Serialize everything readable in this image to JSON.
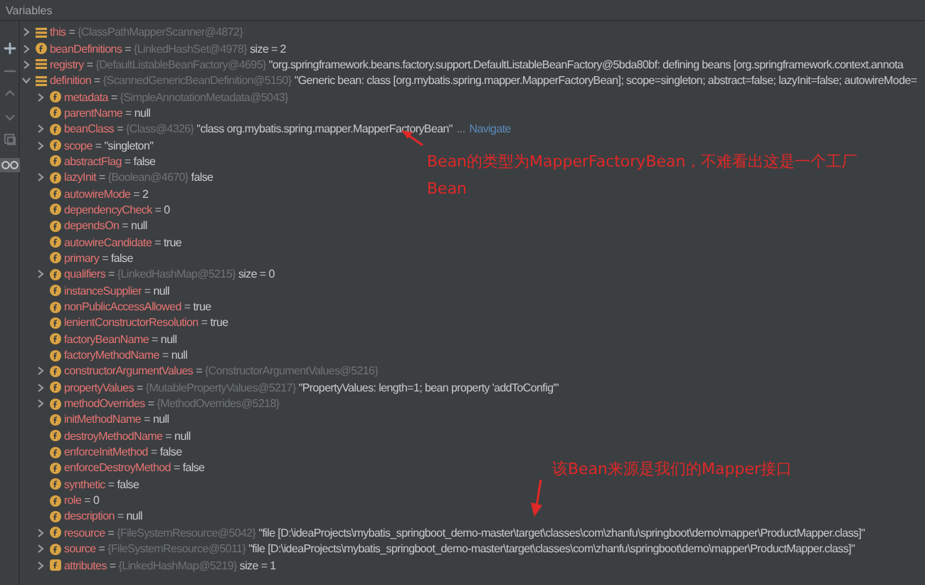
{
  "panel": {
    "title": "Variables"
  },
  "variables": [
    {
      "name": "this",
      "eq": "=",
      "ref": "{ClassPathMapperScanner@4872}",
      "kind": "object",
      "expanded": false
    },
    {
      "name": "beanDefinitions",
      "eq": "=",
      "ref": "{LinkedHashSet@4978}",
      "value": "size = 2",
      "kind": "field",
      "expanded": false
    },
    {
      "name": "registry",
      "eq": "=",
      "ref": "{DefaultListableBeanFactory@4695}",
      "value": "\"org.springframework.beans.factory.support.DefaultListableBeanFactory@5bda80bf: defining beans [org.springframework.context.annota",
      "kind": "object",
      "expanded": false
    },
    {
      "name": "definition",
      "eq": "=",
      "ref": "{ScannedGenericBeanDefinition@5150}",
      "value": "\"Generic bean: class [org.mybatis.spring.mapper.MapperFactoryBean]; scope=singleton; abstract=false; lazyInit=false; autowireMode=",
      "kind": "object",
      "expanded": true,
      "children": [
        {
          "name": "metadata",
          "eq": "=",
          "ref": "{SimpleAnnotationMetadata@5043}",
          "kind": "field",
          "expanded": false
        },
        {
          "name": "parentName",
          "eq": "=",
          "value": "null",
          "kind": "field"
        },
        {
          "name": "beanClass",
          "eq": "=",
          "ref": "{Class@4326}",
          "value": "\"class org.mybatis.spring.mapper.MapperFactoryBean\"",
          "more": "...",
          "link": "Navigate",
          "kind": "field",
          "expanded": false
        },
        {
          "name": "scope",
          "eq": "=",
          "value": "\"singleton\"",
          "kind": "field",
          "expanded": false
        },
        {
          "name": "abstractFlag",
          "eq": "=",
          "value": "false",
          "kind": "field"
        },
        {
          "name": "lazyInit",
          "eq": "=",
          "ref": "{Boolean@4670}",
          "value": "false",
          "kind": "field",
          "expanded": false
        },
        {
          "name": "autowireMode",
          "eq": "=",
          "value": "2",
          "kind": "field"
        },
        {
          "name": "dependencyCheck",
          "eq": "=",
          "value": "0",
          "kind": "field"
        },
        {
          "name": "dependsOn",
          "eq": "=",
          "value": "null",
          "kind": "field"
        },
        {
          "name": "autowireCandidate",
          "eq": "=",
          "value": "true",
          "kind": "field"
        },
        {
          "name": "primary",
          "eq": "=",
          "value": "false",
          "kind": "field"
        },
        {
          "name": "qualifiers",
          "eq": "=",
          "ref": "{LinkedHashMap@5215}",
          "value": "size = 0",
          "kind": "field",
          "expanded": false
        },
        {
          "name": "instanceSupplier",
          "eq": "=",
          "value": "null",
          "kind": "field"
        },
        {
          "name": "nonPublicAccessAllowed",
          "eq": "=",
          "value": "true",
          "kind": "field"
        },
        {
          "name": "lenientConstructorResolution",
          "eq": "=",
          "value": "true",
          "kind": "field"
        },
        {
          "name": "factoryBeanName",
          "eq": "=",
          "value": "null",
          "kind": "field"
        },
        {
          "name": "factoryMethodName",
          "eq": "=",
          "value": "null",
          "kind": "field"
        },
        {
          "name": "constructorArgumentValues",
          "eq": "=",
          "ref": "{ConstructorArgumentValues@5216}",
          "kind": "field",
          "expanded": false
        },
        {
          "name": "propertyValues",
          "eq": "=",
          "ref": "{MutablePropertyValues@5217}",
          "value": "\"PropertyValues: length=1; bean property 'addToConfig'\"",
          "kind": "field",
          "expanded": false
        },
        {
          "name": "methodOverrides",
          "eq": "=",
          "ref": "{MethodOverrides@5218}",
          "kind": "field",
          "expanded": false
        },
        {
          "name": "initMethodName",
          "eq": "=",
          "value": "null",
          "kind": "field"
        },
        {
          "name": "destroyMethodName",
          "eq": "=",
          "value": "null",
          "kind": "field"
        },
        {
          "name": "enforceInitMethod",
          "eq": "=",
          "value": "false",
          "kind": "field"
        },
        {
          "name": "enforceDestroyMethod",
          "eq": "=",
          "value": "false",
          "kind": "field"
        },
        {
          "name": "synthetic",
          "eq": "=",
          "value": "false",
          "kind": "field"
        },
        {
          "name": "role",
          "eq": "=",
          "value": "0",
          "kind": "field"
        },
        {
          "name": "description",
          "eq": "=",
          "value": "null",
          "kind": "field"
        },
        {
          "name": "resource",
          "eq": "=",
          "ref": "{FileSystemResource@5042}",
          "value": "\"file [D:\\ideaProjects\\mybatis_springboot_demo-master\\target\\classes\\com\\zhanfu\\springboot\\demo\\mapper\\ProductMapper.class]\"",
          "kind": "field",
          "expanded": false
        },
        {
          "name": "source",
          "eq": "=",
          "ref": "{FileSystemResource@5011}",
          "value": "\"file [D:\\ideaProjects\\mybatis_springboot_demo-master\\target\\classes\\com\\zhanfu\\springboot\\demo\\mapper\\ProductMapper.class]\"",
          "kind": "field",
          "expanded": false
        },
        {
          "name": "attributes",
          "eq": "=",
          "ref": "{LinkedHashMap@5219}",
          "value": "size = 1",
          "kind": "field_map",
          "expanded": false
        }
      ]
    }
  ],
  "annotations": [
    {
      "text": "Bean的类型为MapperFactoryBean，不难看出这是一个工厂Bean"
    },
    {
      "text": "该Bean来源是我们的Mapper接口"
    }
  ]
}
